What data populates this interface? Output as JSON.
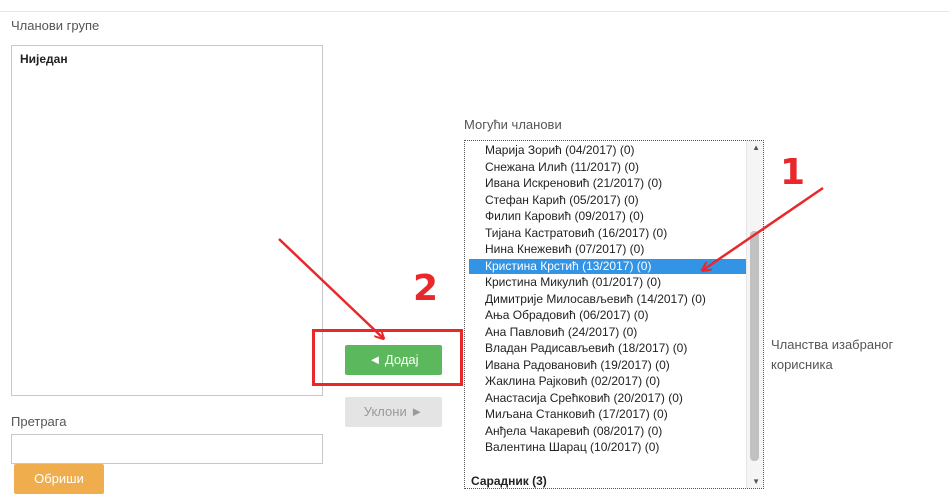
{
  "members": {
    "title": "Чланови групе",
    "empty_text": "Ниједан"
  },
  "search": {
    "label": "Претрага",
    "value": "",
    "clear_label": "Обриши"
  },
  "actions": {
    "add_label": "◄ Додај",
    "remove_label": "Уклони ►"
  },
  "potential": {
    "title": "Могући чланови",
    "items": [
      "Марија Зорић (04/2017) (0)",
      "Снежана Илић (11/2017) (0)",
      "Ивана Искреновић (21/2017) (0)",
      "Стефан Карић (05/2017) (0)",
      "Филип Каровић (09/2017) (0)",
      "Тијана Кастратовић (16/2017) (0)",
      "Нина Кнежевић (07/2017) (0)",
      "Кристина Крстић (13/2017) (0)",
      "Кристина Микулић (01/2017) (0)",
      "Димитрије Милосављевић (14/2017) (0)",
      "Ања Обрадовић (06/2017) (0)",
      "Ана Павловић (24/2017) (0)",
      "Владан Радисављевић (18/2017) (0)",
      "Ивана Радовановић (19/2017) (0)",
      "Жаклина Рајковић (02/2017) (0)",
      "Анастасија Срећковић (20/2017) (0)",
      "Миљана Станковић (17/2017) (0)",
      "Анђела Чакаревић (08/2017) (0)",
      "Валентина Шарац (10/2017) (0)"
    ],
    "selected_index": 7,
    "group_header": "Сарадник (3)"
  },
  "memberships": {
    "line1": "Чланства изабраног",
    "line2": "корисника"
  },
  "annotations": {
    "one": "1",
    "two": "2",
    "color": "#e8282b"
  },
  "colors": {
    "add": "#5cb85c",
    "clear": "#f0ad4e",
    "selected": "#3393e5"
  }
}
